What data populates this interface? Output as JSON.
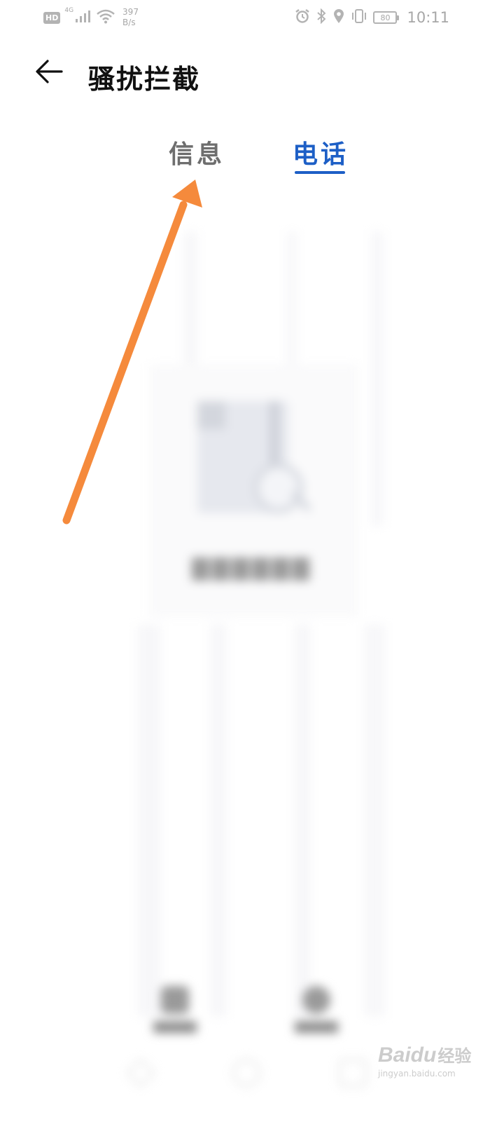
{
  "status_bar": {
    "hd_badge": "HD",
    "network_type": "4G",
    "speed_value": "397",
    "speed_unit": "B/s",
    "battery_level": "80",
    "time": "10:11",
    "icons": [
      "signal-icon",
      "wifi-icon",
      "alarm-icon",
      "bluetooth-icon",
      "location-icon",
      "vibrate-icon",
      "battery-icon"
    ]
  },
  "header": {
    "back_icon": "back-arrow-icon",
    "title": "骚扰拦截"
  },
  "tabs": [
    {
      "label": "信息",
      "active": false
    },
    {
      "label": "电话",
      "active": true
    }
  ],
  "colors": {
    "accent": "#1d5fc6",
    "inactive_tab": "#6e6e6e",
    "annotation_arrow": "#f58a3c"
  },
  "watermark": {
    "logo": "Baidu",
    "logo_cn": "经验",
    "url": "jingyan.baidu.com"
  }
}
